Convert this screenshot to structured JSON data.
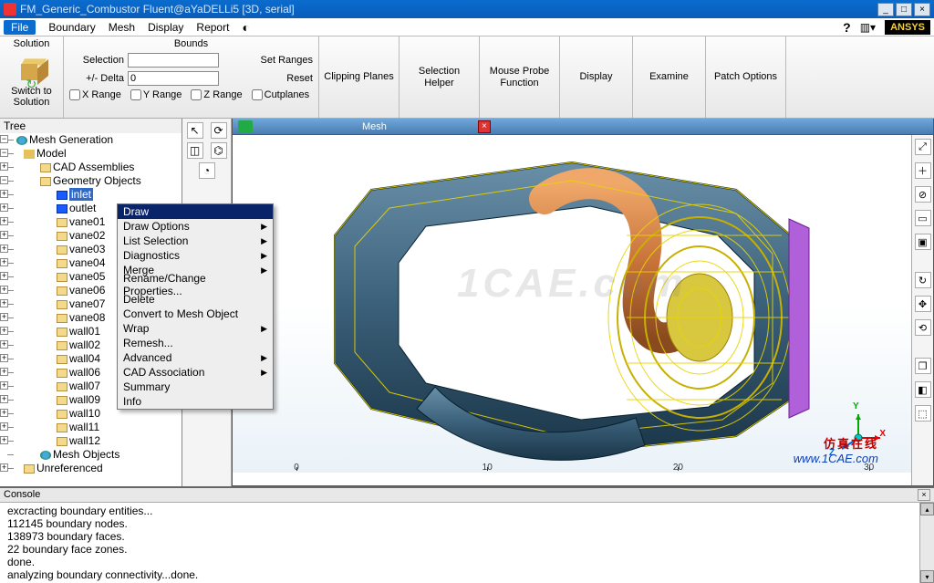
{
  "title": "FM_Generic_Combustor Fluent@aYaDELLi5  [3D, serial]",
  "menubar": [
    "File",
    "Boundary",
    "Mesh",
    "Display",
    "Report"
  ],
  "brand": "ANSYS",
  "ribbon": {
    "solution_label": "Solution",
    "switch_btn": "Switch to Solution",
    "bounds_label": "Bounds",
    "selection_lbl": "Selection",
    "selection_val": "",
    "delta_lbl": "+/- Delta",
    "delta_val": "0",
    "setranges": "Set Ranges",
    "reset": "Reset",
    "xr": "X Range",
    "yr": "Y Range",
    "zr": "Z Range",
    "cut": "Cutplanes",
    "btns": [
      "Clipping Planes",
      "Selection Helper",
      "Mouse Probe Function",
      "Display",
      "Examine",
      "Patch Options"
    ]
  },
  "tree_hdr": "Tree",
  "tree_root": "Mesh Generation",
  "tree_model": "Model",
  "tree_cad": "CAD Assemblies",
  "tree_geom": "Geometry Objects",
  "tree_items": [
    "inlet",
    "outlet",
    "vane01",
    "vane02",
    "vane03",
    "vane04",
    "vane05",
    "vane06",
    "vane07",
    "vane08",
    "wall01",
    "wall02",
    "wall04",
    "wall06",
    "wall07",
    "wall09",
    "wall10",
    "wall11",
    "wall12"
  ],
  "tree_meshobj": "Mesh Objects",
  "tree_unref": "Unreferenced",
  "viewtab": "Mesh",
  "ctx": [
    "Draw",
    "Draw Options",
    "List Selection",
    "Diagnostics",
    "Merge",
    "Rename/Change Properties...",
    "Delete",
    "Convert to Mesh Object",
    "Wrap",
    "Remesh...",
    "Advanced",
    "CAD Association",
    "Summary",
    "Info"
  ],
  "ctx_arrows": [
    1,
    2,
    3,
    4,
    8,
    10,
    11
  ],
  "scale_ticks": [
    "0",
    "10",
    "20",
    "30"
  ],
  "console_hdr": "Console",
  "console_lines": [
    "excracting boundary entities...",
    " 112145 boundary nodes.",
    " 138973 boundary faces.",
    " 22 boundary face zones.",
    "done.",
    "analyzing boundary connectivity...done."
  ],
  "watermark_cn": "仿真在线",
  "watermark_url": "www.1CAE.com",
  "center_wm": "1CAE.com"
}
